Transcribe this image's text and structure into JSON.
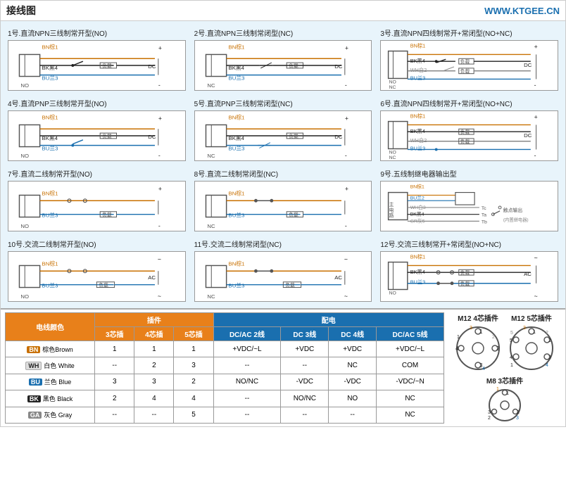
{
  "header": {
    "title": "接线图",
    "url": "WWW.KTGEE.CN"
  },
  "diagrams": [
    {
      "id": 1,
      "title": "1号.直流NPN三线制常开型(NO)",
      "type": "NPN3NO",
      "labels": [
        "BN棕1",
        "BK黑4",
        "BU兰3",
        "NO",
        "+",
        "-",
        "负载",
        "DC"
      ]
    },
    {
      "id": 2,
      "title": "2号.直流NPN三线制常闭型(NC)",
      "type": "NPN3NC",
      "labels": [
        "BN棕1",
        "BK黑4",
        "BU兰3",
        "NC",
        "+",
        "-",
        "负载",
        "DC"
      ]
    },
    {
      "id": 3,
      "title": "3号.直流NPN四线制常开+常闭型(NO+NC)",
      "type": "NPN4NONC",
      "labels": [
        "BN棕1",
        "BK黑4",
        "WH白2",
        "BU兰3",
        "NO",
        "NC",
        "+",
        "-",
        "负载",
        "负载",
        "DC"
      ]
    },
    {
      "id": 4,
      "title": "4号.直流PNP三线制常开型(NO)",
      "type": "PNP3NO",
      "labels": [
        "BN棕1",
        "BK黑4",
        "BU兰3",
        "NO",
        "+",
        "-",
        "负载",
        "DC"
      ]
    },
    {
      "id": 5,
      "title": "5号.直流PNP三线制常闭型(NC)",
      "type": "PNP3NC",
      "labels": [
        "BN棕1",
        "BK黑4",
        "BU兰3",
        "NC",
        "+",
        "-",
        "负载",
        "DC"
      ]
    },
    {
      "id": 6,
      "title": "6号.直流NPN四线制常开+常闭型(NO+NC)",
      "type": "NPN4NONC2",
      "labels": [
        "BN棕1",
        "BK黑4",
        "WH白2",
        "BU兰3",
        "NO",
        "NC",
        "+",
        "-",
        "负载",
        "负载",
        "DC"
      ]
    },
    {
      "id": 7,
      "title": "7号.直流二线制常开型(NO)",
      "type": "2WIRE_NO",
      "labels": [
        "BN棕1",
        "BU兰3",
        "NO",
        "+",
        "-",
        "负载"
      ]
    },
    {
      "id": 8,
      "title": "8号.直流二线制常闭型(NC)",
      "type": "2WIRE_NC",
      "labels": [
        "BN棕1",
        "BU兰3",
        "NC",
        "+",
        "-",
        "负载"
      ]
    },
    {
      "id": 9,
      "title": "9号.五线制继电器输出型",
      "type": "RELAY5",
      "labels": [
        "BN棕1",
        "BU兰2",
        "WH白3",
        "BK黑4",
        "GR灰5",
        "主电路",
        "Tc",
        "Ta",
        "Tb",
        "触点输出",
        "内置继电器"
      ]
    },
    {
      "id": 10,
      "title": "10号.交流二线制常开型(NO)",
      "type": "AC2WIRE_NO",
      "labels": [
        "BN棕1",
        "BU兰3",
        "NO",
        "~",
        "AC",
        "负载"
      ]
    },
    {
      "id": 11,
      "title": "11号.交流二线制常闭型(NC)",
      "type": "AC2WIRE_NC",
      "labels": [
        "BN棕1",
        "BU兰3",
        "NC",
        "~",
        "AC",
        "负载"
      ]
    },
    {
      "id": 12,
      "title": "12号.交流三线制常开+常闭型(NO+NC)",
      "type": "AC3WIRE_NONC",
      "labels": [
        "BN棕1",
        "BK黑4",
        "BU兰3",
        "NO",
        "~",
        "AC",
        "负载",
        "负载"
      ]
    }
  ],
  "table": {
    "header_col1": "电线颜色",
    "plugin_header": "插件",
    "power_header": "配电",
    "plugin_cols": [
      "3芯插",
      "4芯插",
      "5芯插"
    ],
    "power_cols": [
      "DC/AC 2线",
      "DC 3线",
      "DC 4线",
      "DC/AC 5线"
    ],
    "rows": [
      {
        "code": "BN",
        "name": "棕色Brown",
        "color_class": "color-bn",
        "plugin": [
          "1",
          "1",
          "1"
        ],
        "power": [
          "+VDC/~L",
          "+VDC",
          "+VDC",
          "+VDC/~L"
        ]
      },
      {
        "code": "WH",
        "name": "白色 White",
        "color_class": "color-wh",
        "plugin": [
          "--",
          "2",
          "3"
        ],
        "power": [
          "--",
          "--",
          "NC",
          "COM"
        ]
      },
      {
        "code": "BU",
        "name": "兰色 Blue",
        "color_class": "color-bu",
        "plugin": [
          "3",
          "3",
          "2"
        ],
        "power": [
          "NO/NC",
          "-VDC",
          "-VDC",
          "-VDC/~N"
        ]
      },
      {
        "code": "BK",
        "name": "黑色 Black",
        "color_class": "color-bk",
        "plugin": [
          "2",
          "4",
          "4"
        ],
        "power": [
          "--",
          "NO/NC",
          "NO",
          "NC"
        ]
      },
      {
        "code": "GA",
        "name": "灰色 Gray",
        "color_class": "color-ga",
        "plugin": [
          "--",
          "--",
          "5"
        ],
        "power": [
          "--",
          "--",
          "--",
          "NC"
        ]
      }
    ]
  },
  "connectors": {
    "m12_4pin_label": "M12 4芯插件",
    "m12_5pin_label": "M12 5芯插件",
    "m8_3pin_label": "M8 3芯插件"
  }
}
